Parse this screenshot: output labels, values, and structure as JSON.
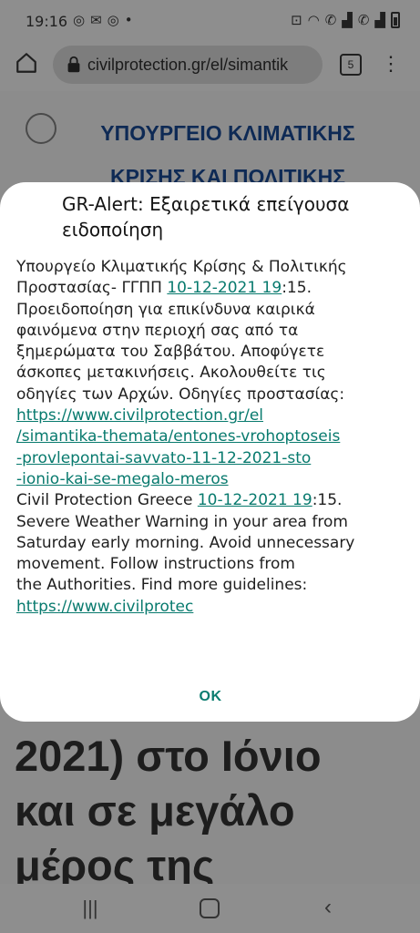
{
  "status_bar": {
    "time": "19:16",
    "notification_icons": [
      "chrome-icon",
      "mail-icon",
      "chrome-icon",
      "dot-icon"
    ],
    "system_icons": [
      "lock-icon",
      "wifi-icon",
      "call-icon",
      "signal-icon",
      "call-icon",
      "signal-icon",
      "battery-icon"
    ]
  },
  "browser": {
    "url": "civilprotection.gr/el/simantik",
    "tab_count": "5"
  },
  "background_page": {
    "header": "ΥΠΟΥΡΓΕΙΟ ΚΛΙΜΑΤΙΚΗΣ ΚΡΙΣΗΣ ΚΑΙ ΠΟΛΙΤΙΚΗΣ",
    "big_text_lines": [
      "2021) στο Ιόνιο",
      "και σε μεγάλο",
      "μέρος της"
    ]
  },
  "dialog": {
    "title": "GR-Alert: Εξαιρετικά επείγουσα ειδοποίηση",
    "body_lines": [
      [
        {
          "text": "Υπουργείο Κλιματικής Κρίσης & Πολιτικής"
        }
      ],
      [
        {
          "text": "Προστασίας- ΓΓΠΠ "
        },
        {
          "text": "10-12-2021 19",
          "link": true
        },
        {
          "text": ":15."
        }
      ],
      [
        {
          "text": "Προειδοποίηση για επικίνδυνα καιρικά"
        }
      ],
      [
        {
          "text": "φαινόμενα στην περιοχή σας από τα"
        }
      ],
      [
        {
          "text": "ξημερώματα του Σαββάτου. Αποφύγετε"
        }
      ],
      [
        {
          "text": "άσκοπες μετακινήσεις. Ακολουθείτε τις"
        }
      ],
      [
        {
          "text": "οδηγίες των Αρχών. Οδηγίες προστασίας:"
        }
      ],
      [
        {
          "text": "https://www.civilprotection.gr/el",
          "link": true
        }
      ],
      [
        {
          "text": "/simantika-themata/entones-vrohoptoseis",
          "link": true
        }
      ],
      [
        {
          "text": "-provlepontai-savvato-11-12-2021-sto",
          "link": true
        }
      ],
      [
        {
          "text": "-ionio-kai-se-megalo-meros",
          "link": true
        }
      ],
      [
        {
          "text": "Civil Protection Greece "
        },
        {
          "text": "10-12-2021 19",
          "link": true
        },
        {
          "text": ":15."
        }
      ],
      [
        {
          "text": "Severe Weather Warning in your area from"
        }
      ],
      [
        {
          "text": "Saturday early morning. Avoid unnecessary"
        }
      ],
      [
        {
          "text": "movement. Follow instructions from"
        }
      ],
      [
        {
          "text": "the Authorities. Find more guidelines:"
        }
      ],
      [
        {
          "text": "https://www.civilprotec",
          "link": true
        }
      ]
    ],
    "ok_label": "OK"
  },
  "colors": {
    "link": "#087a6e",
    "header_blue": "#0e2a55",
    "dim_background": "#8c8c8c"
  }
}
